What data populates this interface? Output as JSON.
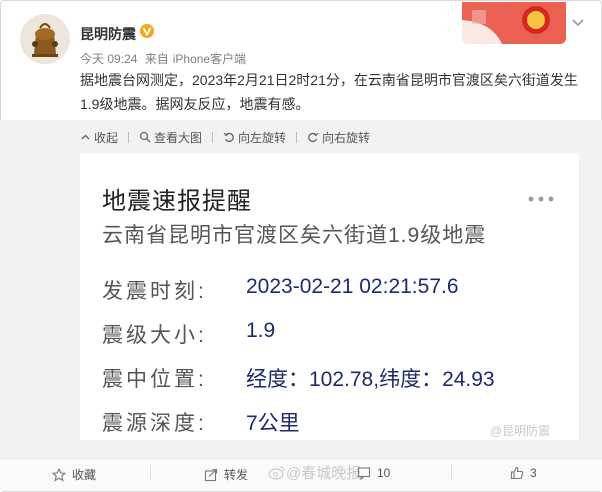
{
  "post": {
    "username": "昆明防震",
    "time": "今天 09:24",
    "source_prefix": "来自",
    "source": "iPhone客户端",
    "text": "据地震台网测定，2023年2月21日2时21分，在云南省昆明市官渡区矣六街道发生1.9级地震。据网友反应，地震有感。"
  },
  "toolbar": {
    "collapse": "收起",
    "view_large": "查看大图",
    "rotate_left": "向左旋转",
    "rotate_right": "向右旋转"
  },
  "card": {
    "title": "地震速报提醒",
    "subtitle": "云南省昆明市官渡区矣六街道1.9级地震",
    "rows": [
      {
        "label": "发震时刻:",
        "value": "2023-02-21 02:21:57.6"
      },
      {
        "label": "震级大小:",
        "value": "1.9"
      },
      {
        "label": "震中位置:",
        "value": "经度：102.78,纬度：24.93"
      },
      {
        "label": "震源深度:",
        "value": "7公里"
      }
    ],
    "watermark": "@昆明防震"
  },
  "footer": {
    "favorite": "收藏",
    "repost": "转发",
    "watermark": "@春城晚报",
    "comment_count": "10",
    "like_count": "3"
  },
  "colors": {
    "accent_blue": "#1e2a6a",
    "verified_yellow": "#f5a623",
    "banner_red": "#d7261e"
  }
}
